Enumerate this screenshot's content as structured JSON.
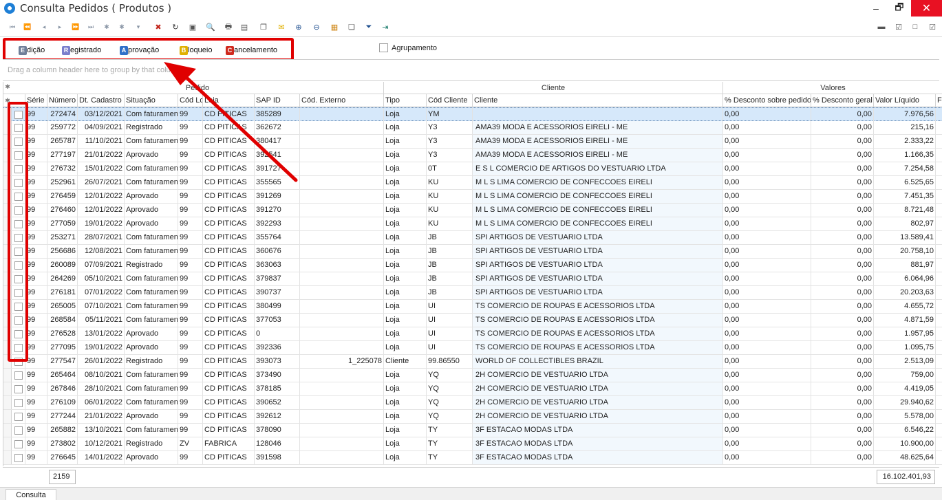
{
  "window": {
    "title": "Consulta Pedidos ( Produtos )",
    "minimize": "–",
    "maximize": "🗗",
    "close": "✕"
  },
  "toolbar": {
    "nav_icons": [
      "first-record-icon",
      "prior-page-icon",
      "prior-record-icon",
      "next-record-icon",
      "next-page-icon",
      "last-record-icon",
      "insert-icon",
      "append-icon",
      "filter-arrow-icon"
    ],
    "action_icons": [
      "delete-icon",
      "refresh-icon",
      "properties-icon",
      "preview-icon",
      "print-icon",
      "export-icon",
      "copy-icon",
      "email-icon",
      "zoom-in-icon",
      "zoom-out-icon",
      "layout-icon",
      "windows-icon",
      "filter-icon",
      "exit-icon"
    ],
    "right_icons": [
      "view-1-icon",
      "view-2-icon",
      "view-3-icon",
      "view-4-icon"
    ]
  },
  "legend": {
    "items": [
      {
        "letter": "E",
        "rest": "dição",
        "color": "#6f7f99"
      },
      {
        "letter": "R",
        "rest": "egistrado",
        "color": "#7a7fcc"
      },
      {
        "letter": "A",
        "rest": "provação",
        "color": "#2f6fc8"
      },
      {
        "letter": "B",
        "rest": "loqueio",
        "color": "#e0b000"
      },
      {
        "letter": "C",
        "rest": "ancelamento",
        "color": "#d02a1e"
      }
    ],
    "agrupamento": "Agrupamento"
  },
  "group_panel": {
    "hint": "Drag a column header here to group by that column"
  },
  "grid": {
    "bands": [
      {
        "label": "Pedido"
      },
      {
        "label": "Cliente"
      },
      {
        "label": "Valores"
      }
    ],
    "columns": [
      "Série",
      "Número",
      "Dt. Cadastro",
      "Situação",
      "Cód Lo",
      "Loja",
      "SAP ID",
      "Cód. Externo",
      "Tipo",
      "Cód Cliente",
      "Cliente",
      "% Desconto sobre pedido",
      "% Desconto geral",
      "Valor Líquido",
      "Fr"
    ],
    "rows": [
      [
        "99",
        "272474",
        "03/12/2021",
        "Com faturamen",
        "99",
        "CD PITICAS",
        "385289",
        "",
        "Loja",
        "YM",
        "",
        "0,00",
        "0,00",
        "7.976,56"
      ],
      [
        "99",
        "259772",
        "04/09/2021",
        "Registrado",
        "99",
        "CD PITICAS",
        "362672",
        "",
        "Loja",
        "Y3",
        "AMA39 MODA E ACESSORIOS EIRELI - ME",
        "0,00",
        "0,00",
        "215,16"
      ],
      [
        "99",
        "265787",
        "11/10/2021",
        "Com faturamen",
        "99",
        "CD PITICAS",
        "380417",
        "",
        "Loja",
        "Y3",
        "AMA39 MODA E ACESSORIOS EIRELI - ME",
        "0,00",
        "0,00",
        "2.333,22"
      ],
      [
        "99",
        "277197",
        "21/01/2022",
        "Aprovado",
        "99",
        "CD PITICAS",
        "392541",
        "",
        "Loja",
        "Y3",
        "AMA39 MODA E ACESSORIOS EIRELI - ME",
        "0,00",
        "0,00",
        "1.166,35"
      ],
      [
        "99",
        "276732",
        "15/01/2022",
        "Com faturamen",
        "99",
        "CD PITICAS",
        "391727",
        "",
        "Loja",
        "0T",
        "E S L COMERCIO DE ARTIGOS DO VESTUARIO LTDA",
        "0,00",
        "0,00",
        "7.254,58"
      ],
      [
        "99",
        "252961",
        "26/07/2021",
        "Com faturamen",
        "99",
        "CD PITICAS",
        "355565",
        "",
        "Loja",
        "KU",
        "M L S LIMA COMERCIO DE CONFECCOES EIRELI",
        "0,00",
        "0,00",
        "6.525,65"
      ],
      [
        "99",
        "276459",
        "12/01/2022",
        "Aprovado",
        "99",
        "CD PITICAS",
        "391269",
        "",
        "Loja",
        "KU",
        "M L S LIMA COMERCIO DE CONFECCOES EIRELI",
        "0,00",
        "0,00",
        "7.451,35"
      ],
      [
        "99",
        "276460",
        "12/01/2022",
        "Aprovado",
        "99",
        "CD PITICAS",
        "391270",
        "",
        "Loja",
        "KU",
        "M L S LIMA COMERCIO DE CONFECCOES EIRELI",
        "0,00",
        "0,00",
        "8.721,48"
      ],
      [
        "99",
        "277059",
        "19/01/2022",
        "Aprovado",
        "99",
        "CD PITICAS",
        "392293",
        "",
        "Loja",
        "KU",
        "M L S LIMA COMERCIO DE CONFECCOES EIRELI",
        "0,00",
        "0,00",
        "802,97"
      ],
      [
        "99",
        "253271",
        "28/07/2021",
        "Com faturamen",
        "99",
        "CD PITICAS",
        "355764",
        "",
        "Loja",
        "JB",
        "SPI ARTIGOS DE VESTUARIO LTDA",
        "0,00",
        "0,00",
        "13.589,41"
      ],
      [
        "99",
        "256686",
        "12/08/2021",
        "Com faturamen",
        "99",
        "CD PITICAS",
        "360676",
        "",
        "Loja",
        "JB",
        "SPI ARTIGOS DE VESTUARIO LTDA",
        "0,00",
        "0,00",
        "20.758,10"
      ],
      [
        "99",
        "260089",
        "07/09/2021",
        "Registrado",
        "99",
        "CD PITICAS",
        "363063",
        "",
        "Loja",
        "JB",
        "SPI ARTIGOS DE VESTUARIO LTDA",
        "0,00",
        "0,00",
        "881,97"
      ],
      [
        "99",
        "264269",
        "05/10/2021",
        "Com faturamen",
        "99",
        "CD PITICAS",
        "379837",
        "",
        "Loja",
        "JB",
        "SPI ARTIGOS DE VESTUARIO LTDA",
        "0,00",
        "0,00",
        "6.064,96"
      ],
      [
        "99",
        "276181",
        "07/01/2022",
        "Com faturamen",
        "99",
        "CD PITICAS",
        "390737",
        "",
        "Loja",
        "JB",
        "SPI ARTIGOS DE VESTUARIO LTDA",
        "0,00",
        "0,00",
        "20.203,63"
      ],
      [
        "99",
        "265005",
        "07/10/2021",
        "Com faturamen",
        "99",
        "CD PITICAS",
        "380499",
        "",
        "Loja",
        "UI",
        "TS COMERCIO DE ROUPAS E ACESSORIOS LTDA",
        "0,00",
        "0,00",
        "4.655,72"
      ],
      [
        "99",
        "268584",
        "05/11/2021",
        "Com faturamen",
        "99",
        "CD PITICAS",
        "377053",
        "",
        "Loja",
        "UI",
        "TS COMERCIO DE ROUPAS E ACESSORIOS LTDA",
        "0,00",
        "0,00",
        "4.871,59"
      ],
      [
        "99",
        "276528",
        "13/01/2022",
        "Aprovado",
        "99",
        "CD PITICAS",
        "0",
        "",
        "Loja",
        "UI",
        "TS COMERCIO DE ROUPAS E ACESSORIOS LTDA",
        "0,00",
        "0,00",
        "1.957,95"
      ],
      [
        "99",
        "277095",
        "19/01/2022",
        "Aprovado",
        "99",
        "CD PITICAS",
        "392336",
        "",
        "Loja",
        "UI",
        "TS COMERCIO DE ROUPAS E ACESSORIOS LTDA",
        "0,00",
        "0,00",
        "1.095,75"
      ],
      [
        "99",
        "277547",
        "26/01/2022",
        "Registrado",
        "99",
        "CD PITICAS",
        "393073",
        "1_225078",
        "Cliente",
        "99.86550",
        "WORLD OF COLLECTIBLES BRAZIL",
        "0,00",
        "0,00",
        "2.513,09"
      ],
      [
        "99",
        "265464",
        "08/10/2021",
        "Com faturamen",
        "99",
        "CD PITICAS",
        "373490",
        "",
        "Loja",
        "YQ",
        "2H COMERCIO DE VESTUARIO LTDA",
        "0,00",
        "0,00",
        "759,00"
      ],
      [
        "99",
        "267846",
        "28/10/2021",
        "Com faturamen",
        "99",
        "CD PITICAS",
        "378185",
        "",
        "Loja",
        "YQ",
        "2H COMERCIO DE VESTUARIO LTDA",
        "0,00",
        "0,00",
        "4.419,05"
      ],
      [
        "99",
        "276109",
        "06/01/2022",
        "Com faturamen",
        "99",
        "CD PITICAS",
        "390652",
        "",
        "Loja",
        "YQ",
        "2H COMERCIO DE VESTUARIO LTDA",
        "0,00",
        "0,00",
        "29.940,62"
      ],
      [
        "99",
        "277244",
        "21/01/2022",
        "Aprovado",
        "99",
        "CD PITICAS",
        "392612",
        "",
        "Loja",
        "YQ",
        "2H COMERCIO DE VESTUARIO LTDA",
        "0,00",
        "0,00",
        "5.578,00"
      ],
      [
        "99",
        "265882",
        "13/10/2021",
        "Com faturamen",
        "99",
        "CD PITICAS",
        "378090",
        "",
        "Loja",
        "TY",
        "3F ESTACAO MODAS LTDA",
        "0,00",
        "0,00",
        "6.546,22"
      ],
      [
        "99",
        "273802",
        "10/12/2021",
        "Registrado",
        "ZV",
        "FABRICA",
        "128046",
        "",
        "Loja",
        "TY",
        "3F ESTACAO MODAS LTDA",
        "0,00",
        "0,00",
        "10.900,00"
      ],
      [
        "99",
        "276645",
        "14/01/2022",
        "Aprovado",
        "99",
        "CD PITICAS",
        "391598",
        "",
        "Loja",
        "TY",
        "3F ESTACAO MODAS LTDA",
        "0,00",
        "0,00",
        "48.625,64"
      ]
    ]
  },
  "footer": {
    "count": "2159",
    "total": "16.102.401,93"
  },
  "tabs": [
    {
      "label": "Consulta"
    }
  ]
}
